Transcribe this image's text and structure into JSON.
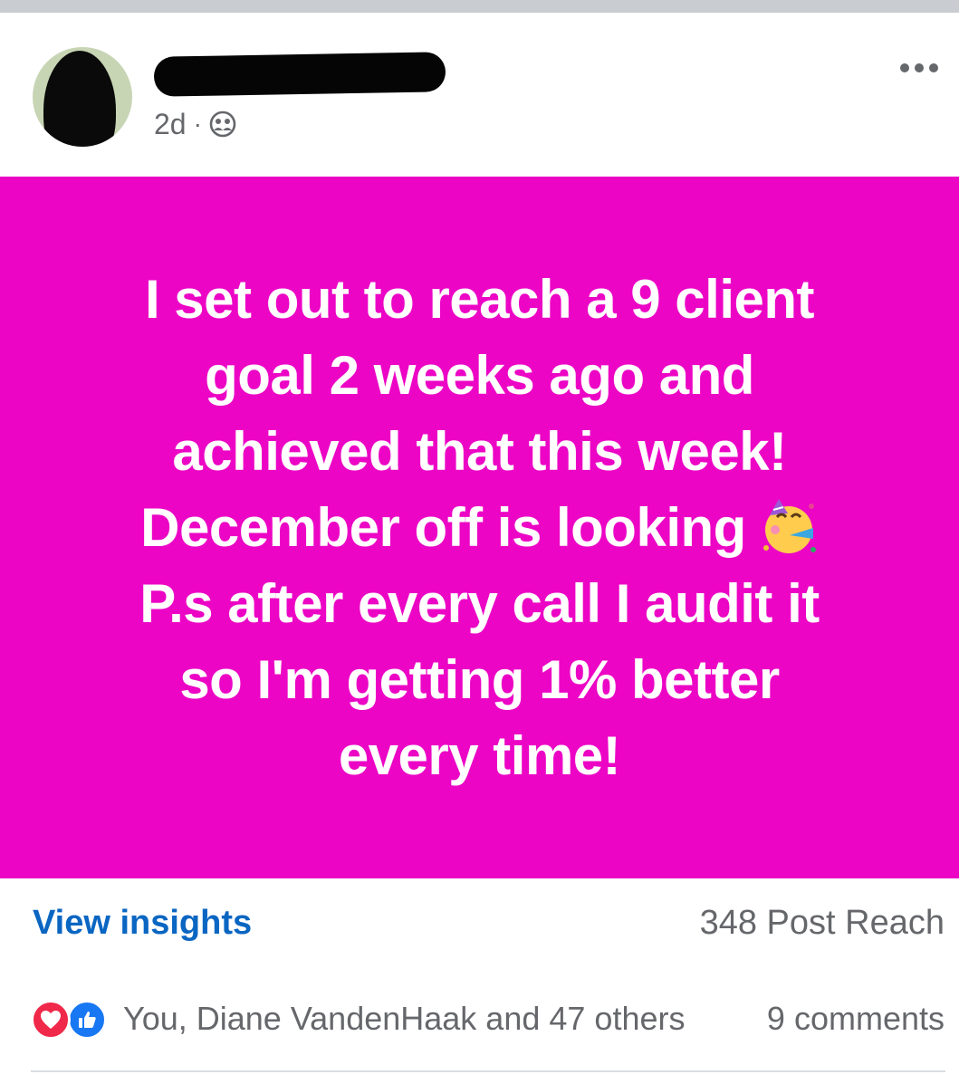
{
  "post": {
    "author_name": "",
    "timestamp": "2d",
    "separator": "·",
    "privacy_icon": "friends-icon",
    "more_icon": "more-horizontal-icon",
    "background_color": "#ec05c5",
    "text_lines": [
      "I set out to reach a 9 client",
      "goal 2 weeks ago and",
      "achieved that this week!",
      "December off is looking",
      "P.s after every call I audit it",
      "so I'm getting 1% better",
      "every time!"
    ],
    "emoji": "🥳"
  },
  "insights": {
    "link_label": "View insights",
    "reach": "348 Post Reach"
  },
  "reactions": {
    "icons": [
      "love-reaction-icon",
      "like-reaction-icon"
    ],
    "summary": "You, Diane VandenHaak and 47 others",
    "comments": "9 comments"
  }
}
